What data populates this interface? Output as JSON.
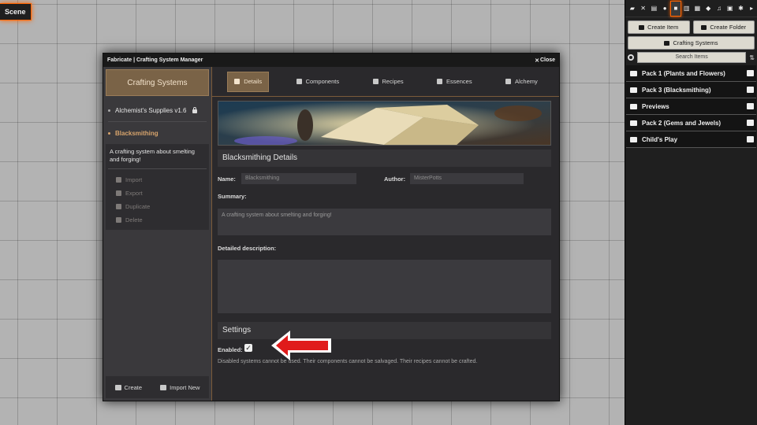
{
  "scene": {
    "label": "Scene"
  },
  "window": {
    "title": "Fabricate | Crafting System Manager",
    "close_label": "Close"
  },
  "left": {
    "title": "Crafting Systems",
    "systems": [
      {
        "name": "Alchemist's Supplies v1.6",
        "locked": true
      },
      {
        "name": "Blacksmithing",
        "locked": false
      }
    ],
    "selected_description": "A crafting system about smelting and forging!",
    "actions": [
      "Import",
      "Export",
      "Duplicate",
      "Delete"
    ],
    "footer": {
      "create": "Create",
      "import_new": "Import New"
    }
  },
  "tabs": [
    "Details",
    "Components",
    "Recipes",
    "Essences",
    "Alchemy"
  ],
  "active_tab": "Details",
  "details": {
    "section_title": "Blacksmithing Details",
    "name_label": "Name:",
    "name_value": "Blacksmithing",
    "author_label": "Author:",
    "author_value": "MisterPotts",
    "summary_label": "Summary:",
    "summary_value": "A crafting system about smelting and forging!",
    "description_label": "Detailed description:",
    "description_value": ""
  },
  "settings": {
    "section_title": "Settings",
    "enabled_label": "Enabled:",
    "enabled": true,
    "note": "Disabled systems cannot be used. Their components cannot be salvaged. Their recipes cannot be crafted."
  },
  "sidebar": {
    "tools": [
      "chat-icon",
      "combat-icon",
      "scenes-icon",
      "actors-icon",
      "items-icon",
      "journal-icon",
      "tables-icon",
      "cards-icon",
      "playlists-icon",
      "compendium-icon",
      "settings-icon",
      "expand-icon"
    ],
    "active_tool": "items-icon",
    "create_item": "Create Item",
    "create_folder": "Create Folder",
    "crafting_systems": "Crafting Systems",
    "search_placeholder": "Search Items",
    "folders": [
      "Pack 1 (Plants and Flowers)",
      "Pack 3 (Blacksmithing)",
      "Previews",
      "Pack 2 (Gems and Jewels)",
      "Child's Play"
    ]
  },
  "colors": {
    "accent": "#7a6347",
    "highlight": "#ff6400",
    "arrow": "#e01b1b"
  }
}
